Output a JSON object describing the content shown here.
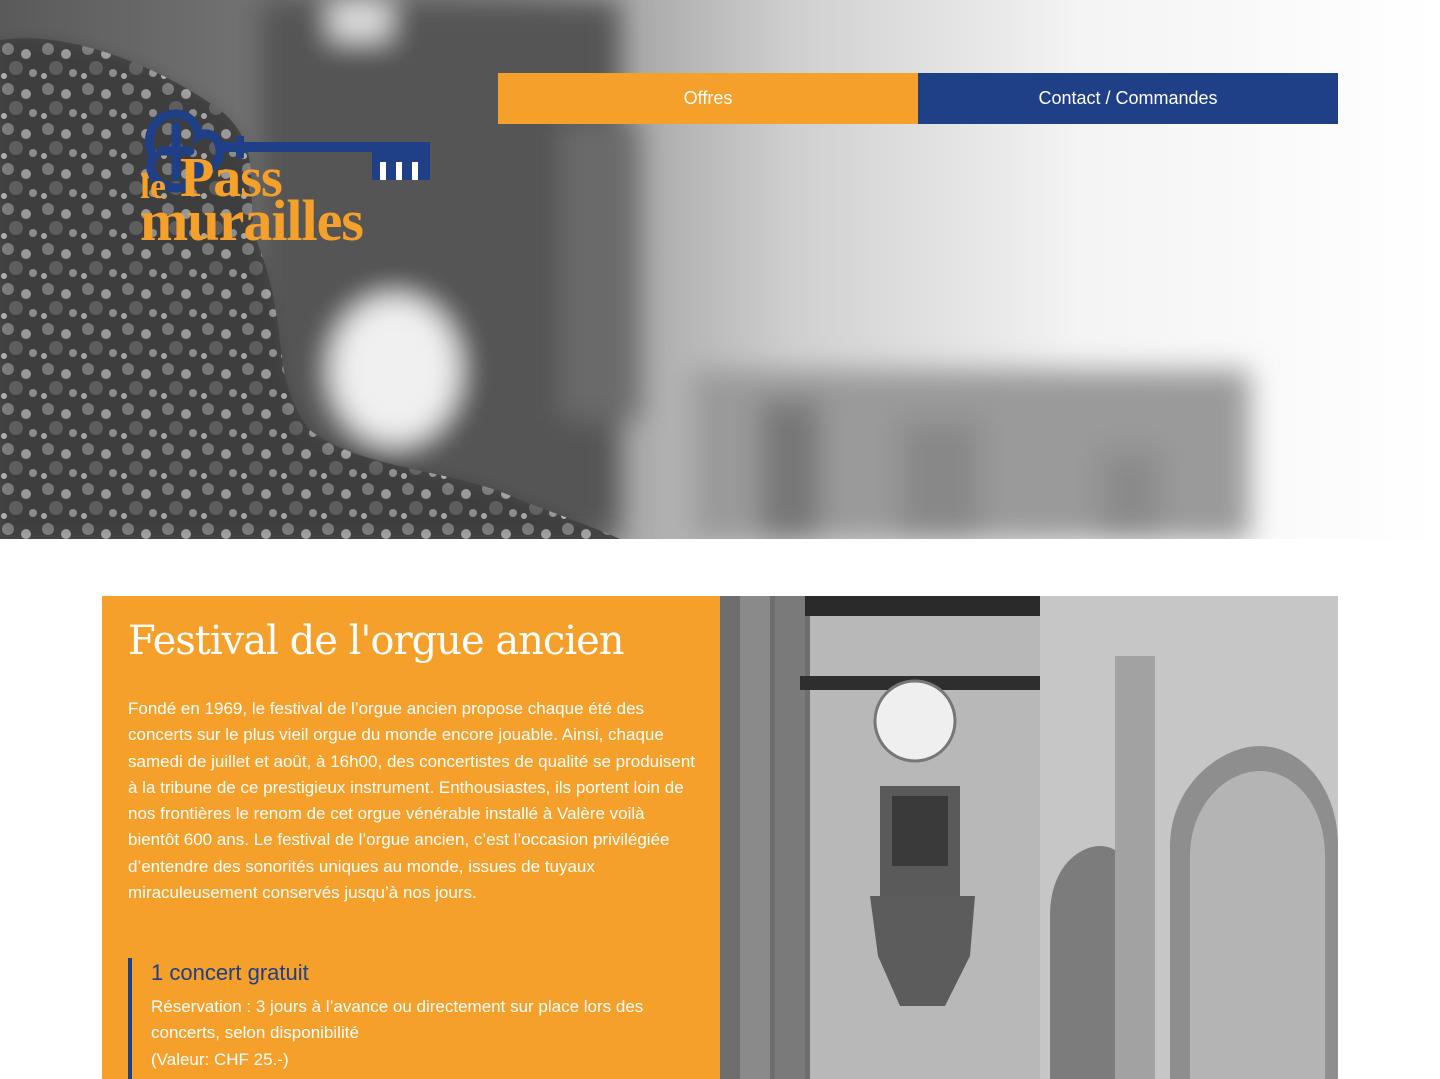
{
  "header": {
    "logo": {
      "word_le": "le",
      "word_pass": "Pass",
      "word_murailles": "murailles",
      "brand_orange": "#F5A02A",
      "brand_blue": "#1F3F86",
      "icon": "key-icon"
    },
    "nav": {
      "offres_label": "Offres",
      "contact_label": "Contact / Commandes"
    }
  },
  "main": {
    "title": "Festival de l'orgue ancien",
    "intro": "Fondé en 1969, le festival de l’orgue ancien propose chaque été des concerts sur le plus vieil orgue du monde encore jouable. Ainsi, chaque samedi de juillet et août, à 16h00, des concertistes de qualité se produisent à la tribune de ce prestigieux instrument. Enthousiastes, ils portent loin de nos frontières le renom de cet orgue vénérable installé à Valère voilà bientôt 600 ans. Le festival de l’orgue ancien, c’est l’occasion privilégiée d’entendre des sonorités uniques au monde, issues de tuyaux miraculeusement conservés jusqu’à nos jours.",
    "offer": {
      "heading": "1 concert gratuit",
      "details": "Réservation : 3 jours à l’avance ou directement sur place lors des concerts, selon disponibilité",
      "value": "(Valeur: CHF 25.-)"
    }
  }
}
